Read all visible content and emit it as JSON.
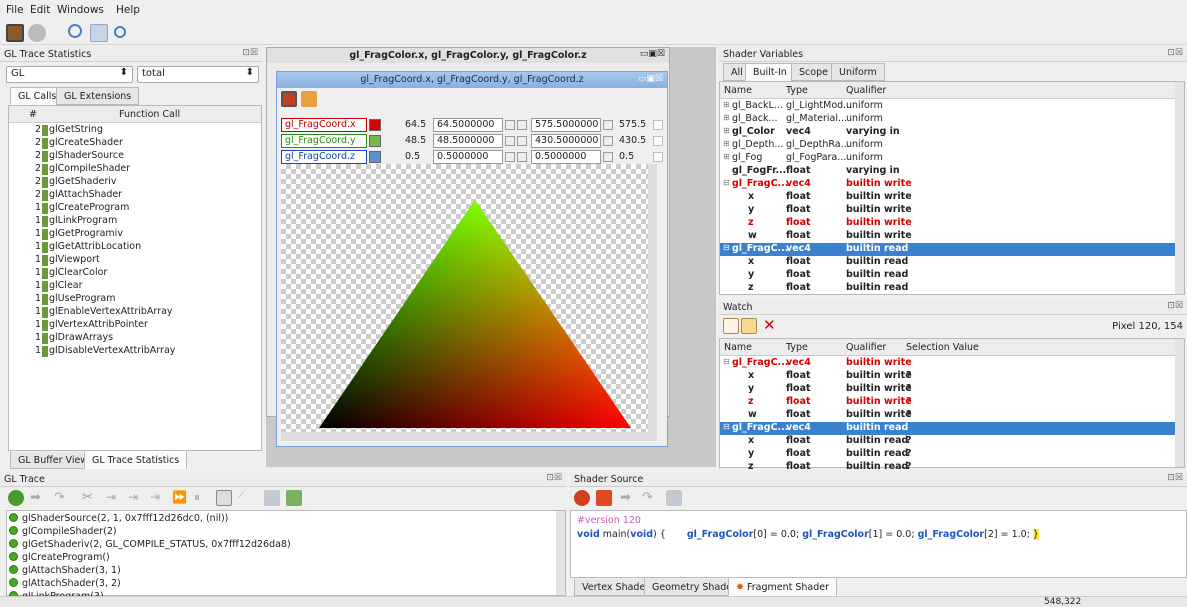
{
  "menu": [
    "File",
    "Edit",
    "Windows",
    "Help"
  ],
  "left": {
    "title": "GL Trace Statistics",
    "sel1": "GL",
    "sel2": "total",
    "tabs": [
      "GL Calls",
      "GL Extensions"
    ],
    "cols": [
      "#",
      "Function Call"
    ],
    "rows": [
      [
        "2",
        "glGetString"
      ],
      [
        "2",
        "glCreateShader"
      ],
      [
        "2",
        "glShaderSource"
      ],
      [
        "2",
        "glCompileShader"
      ],
      [
        "2",
        "glGetShaderiv"
      ],
      [
        "2",
        "glAttachShader"
      ],
      [
        "1",
        "glCreateProgram"
      ],
      [
        "1",
        "glLinkProgram"
      ],
      [
        "1",
        "glGetProgramiv"
      ],
      [
        "1",
        "glGetAttribLocation"
      ],
      [
        "1",
        "glViewport"
      ],
      [
        "1",
        "glClearColor"
      ],
      [
        "1",
        "glClear"
      ],
      [
        "1",
        "glUseProgram"
      ],
      [
        "1",
        "glEnableVertexAttribArray"
      ],
      [
        "1",
        "glVertexAttribPointer"
      ],
      [
        "1",
        "glDrawArrays"
      ],
      [
        "1",
        "glDisableVertexAttribArray"
      ]
    ],
    "bottom_tabs": [
      "GL Buffer View",
      "GL Trace Statistics"
    ]
  },
  "center": {
    "back_title": "gl_FragColor.x, gl_FragColor.y, gl_FragColor.z",
    "title": "gl_FragCoord.x, gl_FragCoord.y, gl_FragCoord.z",
    "channels": [
      {
        "name": "gl_FragCoord.x",
        "val": "64.5",
        "min": "64.5000000",
        "max": "575.5000000",
        "maxv": "575.5",
        "color": "#e00000",
        "tcolor": "#c00000"
      },
      {
        "name": "gl_FragCoord.y",
        "val": "48.5",
        "min": "48.5000000",
        "max": "430.5000000",
        "maxv": "430.5",
        "color": "#7ab648",
        "tcolor": "#2a8a18"
      },
      {
        "name": "gl_FragCoord.z",
        "val": "0.5",
        "min": "0.5000000",
        "max": "0.5000000",
        "maxv": "0.5",
        "color": "#5a8fd0",
        "tcolor": "#1a45b0"
      }
    ]
  },
  "shader_vars": {
    "title": "Shader Variables",
    "tabs": [
      "All",
      "Built-In",
      "Scope",
      "Uniform"
    ],
    "cols": [
      "Name",
      "Type",
      "Qualifier"
    ],
    "rows": [
      [
        "gl_BackL...",
        "gl_LightMod...",
        "uniform",
        "n",
        "+"
      ],
      [
        "gl_Back...",
        "gl_Material...",
        "uniform",
        "n",
        "+"
      ],
      [
        "gl_Color",
        "vec4",
        "varying in",
        "b",
        "+"
      ],
      [
        "gl_Depth...",
        "gl_DepthRa...",
        "uniform",
        "n",
        "+"
      ],
      [
        "gl_Fog",
        "gl_FogPara...",
        "uniform",
        "n",
        "+"
      ],
      [
        "gl_FogFr...",
        "float",
        "varying in",
        "b",
        ""
      ],
      [
        "gl_FragC...",
        "vec4",
        "builtin write",
        "r",
        "-"
      ],
      [
        "x",
        "float",
        "builtin write",
        "b",
        "c"
      ],
      [
        "y",
        "float",
        "builtin write",
        "b",
        "c"
      ],
      [
        "z",
        "float",
        "builtin write",
        "r",
        "c"
      ],
      [
        "w",
        "float",
        "builtin write",
        "b",
        "c"
      ],
      [
        "gl_FragC...",
        "vec4",
        "builtin read",
        "s",
        "-"
      ],
      [
        "x",
        "float",
        "builtin read",
        "b",
        "c"
      ],
      [
        "y",
        "float",
        "builtin read",
        "b",
        "c"
      ],
      [
        "z",
        "float",
        "builtin read",
        "b",
        "c"
      ]
    ]
  },
  "watch": {
    "title": "Watch",
    "pixel": "Pixel 120, 154",
    "cols": [
      "Name",
      "Type",
      "Qualifier",
      "Selection Value"
    ],
    "rows": [
      [
        "gl_FragC...",
        "vec4",
        "builtin write",
        "",
        "r",
        "-"
      ],
      [
        "x",
        "float",
        "builtin write",
        "?",
        "b",
        "c"
      ],
      [
        "y",
        "float",
        "builtin write",
        "?",
        "b",
        "c"
      ],
      [
        "z",
        "float",
        "builtin write",
        "?",
        "r",
        "c"
      ],
      [
        "w",
        "float",
        "builtin write",
        "?",
        "b",
        "c"
      ],
      [
        "gl_FragC...",
        "vec4",
        "builtin read",
        "",
        "s",
        "-"
      ],
      [
        "x",
        "float",
        "builtin read",
        "?",
        "b",
        "c"
      ],
      [
        "y",
        "float",
        "builtin read",
        "?",
        "b",
        "c"
      ],
      [
        "z",
        "float",
        "builtin read",
        "?",
        "b",
        "c"
      ]
    ]
  },
  "trace": {
    "title": "GL Trace",
    "rows": [
      "glShaderSource(2, 1, 0x7fff12d26dc0, (nil))",
      "glCompileShader(2)",
      "glGetShaderiv(2, GL_COMPILE_STATUS, 0x7fff12d26da8)",
      "glCreateProgram()",
      "glAttachShader(3, 1)",
      "glAttachShader(3, 2)",
      "glLinkProgram(3)"
    ]
  },
  "source": {
    "title": "Shader Source",
    "version": "#version 120",
    "kw": "void",
    "main": " main(",
    "kw2": "void",
    "rest": ") {",
    "s1": "gl_FragColor",
    "v1": "[0] = 0.0;",
    "s2": "gl_FragColor",
    "v2": "[1] = 0.0;",
    "s3": "gl_FragColor",
    "v3": "[2] = 1.0;",
    "brace": "}",
    "tabs": [
      "Vertex Shader",
      "Geometry Shader",
      "Fragment Shader"
    ]
  },
  "status": "548,322"
}
